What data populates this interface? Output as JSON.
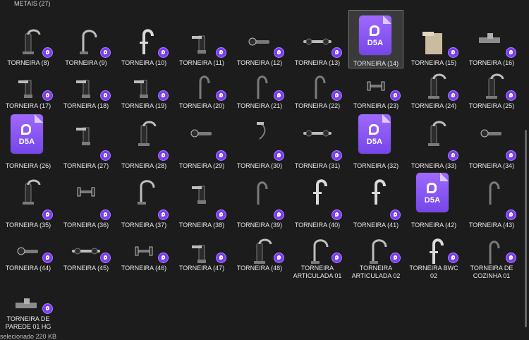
{
  "folder_title": "METAIS (27)",
  "status_text": "selecionado 220 KB",
  "items": [
    {
      "label": "TORNEIRA (8)",
      "thumb": "faucet-tall",
      "type": "model"
    },
    {
      "label": "TORNEIRA (9)",
      "thumb": "faucet-arc",
      "type": "model"
    },
    {
      "label": "TORNEIRA (10)",
      "thumb": "faucet-chrome",
      "type": "model"
    },
    {
      "label": "TORNEIRA (11)",
      "thumb": "faucet-lever",
      "type": "model"
    },
    {
      "label": "TORNEIRA (12)",
      "thumb": "faucet-wall",
      "type": "model"
    },
    {
      "label": "TORNEIRA (13)",
      "thumb": "faucet-bar",
      "type": "model"
    },
    {
      "label": "TORNEIRA (14)",
      "thumb": "d5a",
      "type": "d5a",
      "selected": true
    },
    {
      "label": "TORNEIRA (15)",
      "thumb": "faucet-beige",
      "type": "model"
    },
    {
      "label": "TORNEIRA (16)",
      "thumb": "faucet-wall-metal",
      "type": "model"
    },
    {
      "label": "TORNEIRA (17)",
      "thumb": "faucet-lever",
      "type": "model"
    },
    {
      "label": "TORNEIRA (18)",
      "thumb": "faucet-lever",
      "type": "model"
    },
    {
      "label": "TORNEIRA (19)",
      "thumb": "faucet-lever",
      "type": "model"
    },
    {
      "label": "TORNEIRA (20)",
      "thumb": "faucet-curve",
      "type": "model"
    },
    {
      "label": "TORNEIRA (21)",
      "thumb": "faucet-curve",
      "type": "model"
    },
    {
      "label": "TORNEIRA (22)",
      "thumb": "faucet-curve",
      "type": "model"
    },
    {
      "label": "TORNEIRA (23)",
      "thumb": "faucet-double",
      "type": "model"
    },
    {
      "label": "TORNEIRA (24)",
      "thumb": "faucet-tall",
      "type": "model"
    },
    {
      "label": "TORNEIRA (25)",
      "thumb": "faucet-tall",
      "type": "model"
    },
    {
      "label": "TORNEIRA (26)",
      "thumb": "d5a",
      "type": "d5a"
    },
    {
      "label": "TORNEIRA (27)",
      "thumb": "faucet-lever",
      "type": "model"
    },
    {
      "label": "TORNEIRA (28)",
      "thumb": "faucet-tall",
      "type": "model"
    },
    {
      "label": "TORNEIRA (29)",
      "thumb": "faucet-wall",
      "type": "model"
    },
    {
      "label": "TORNEIRA (30)",
      "thumb": "faucet-shower",
      "type": "model"
    },
    {
      "label": "TORNEIRA (31)",
      "thumb": "faucet-bar",
      "type": "model"
    },
    {
      "label": "TORNEIRA (32)",
      "thumb": "d5a",
      "type": "d5a"
    },
    {
      "label": "TORNEIRA (33)",
      "thumb": "faucet-tall",
      "type": "model"
    },
    {
      "label": "TORNEIRA (34)",
      "thumb": "faucet-wall",
      "type": "model"
    },
    {
      "label": "TORNEIRA (35)",
      "thumb": "faucet-tall",
      "type": "model"
    },
    {
      "label": "TORNEIRA (36)",
      "thumb": "faucet-double",
      "type": "model"
    },
    {
      "label": "TORNEIRA (37)",
      "thumb": "faucet-arc",
      "type": "model"
    },
    {
      "label": "TORNEIRA (38)",
      "thumb": "faucet-lever",
      "type": "model"
    },
    {
      "label": "TORNEIRA (39)",
      "thumb": "faucet-curve",
      "type": "model"
    },
    {
      "label": "TORNEIRA (40)",
      "thumb": "faucet-chrome",
      "type": "model"
    },
    {
      "label": "TORNEIRA (41)",
      "thumb": "faucet-chrome",
      "type": "model"
    },
    {
      "label": "TORNEIRA (42)",
      "thumb": "d5a",
      "type": "d5a"
    },
    {
      "label": "TORNEIRA (43)",
      "thumb": "faucet-curve",
      "type": "model"
    },
    {
      "label": "TORNEIRA (44)",
      "thumb": "faucet-wall",
      "type": "model"
    },
    {
      "label": "TORNEIRA (45)",
      "thumb": "faucet-bar",
      "type": "model"
    },
    {
      "label": "TORNEIRA (46)",
      "thumb": "faucet-double",
      "type": "model"
    },
    {
      "label": "TORNEIRA (47)",
      "thumb": "faucet-lever",
      "type": "model"
    },
    {
      "label": "TORNEIRA (48)",
      "thumb": "faucet-tall",
      "type": "model"
    },
    {
      "label": "TORNEIRA ARTICULADA 01",
      "thumb": "faucet-arc",
      "type": "model"
    },
    {
      "label": "TORNEIRA ARTICULADA 02",
      "thumb": "faucet-arc",
      "type": "model"
    },
    {
      "label": "TORNEIRA BWC 02",
      "thumb": "faucet-chrome",
      "type": "model"
    },
    {
      "label": "TORNEIRA DE COZINHA 01",
      "thumb": "faucet-curve",
      "type": "model"
    },
    {
      "label": "TORNEIRA DE PAREDE 01 HG",
      "thumb": "faucet-wall-metal",
      "type": "model"
    }
  ],
  "colors": {
    "background": "#1c1c1c",
    "badge": "#7b3cf5",
    "d5a_gradient_top": "#9f69ff",
    "d5a_gradient_bottom": "#7546e8",
    "selection": "#3a3a3a"
  },
  "d5a_label": "D5A"
}
